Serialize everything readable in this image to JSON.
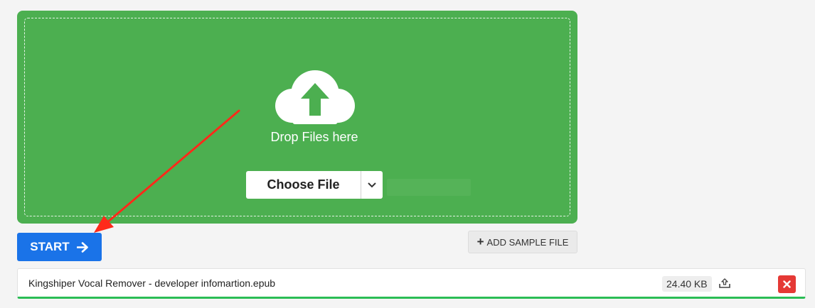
{
  "dropzone": {
    "text": "Drop Files here",
    "choose_label": "Choose File",
    "bg_color": "#4caf50"
  },
  "start": {
    "label": "START",
    "color": "#1a73e8",
    "icon": "arrow-right-icon"
  },
  "sample": {
    "label": "ADD SAMPLE FILE",
    "icon": "plus-icon"
  },
  "file": {
    "name": "Kingshiper Vocal Remover - developer infomartion.epub",
    "size": "24.40 KB",
    "progress_color": "#2bbd55",
    "upload_icon": "upload-icon",
    "remove_icon": "close-icon"
  },
  "annotation": {
    "color": "#ff2a1a"
  }
}
